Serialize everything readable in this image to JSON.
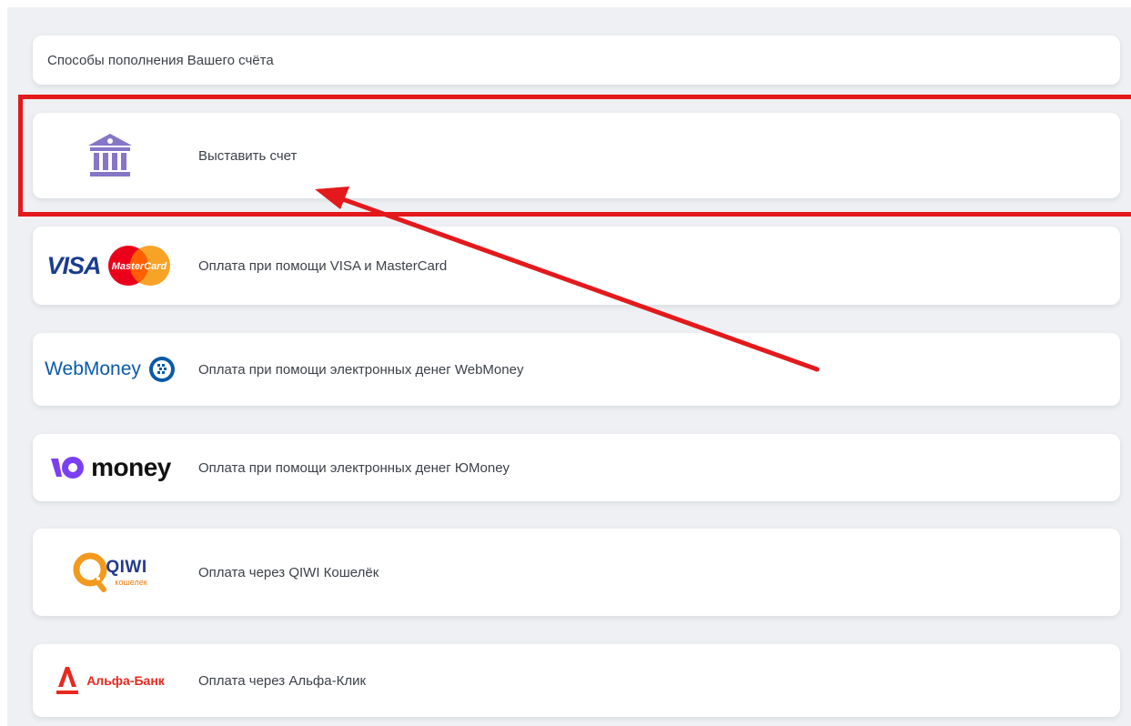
{
  "header": {
    "title": "Способы пополнения Вашего счёта"
  },
  "methods": [
    {
      "label": "Выставить счет",
      "icon": "bank-icon"
    },
    {
      "label": "Оплата при помощи VISA и MasterCard",
      "icon": "visa-mastercard-logo",
      "logo_text": "VISA",
      "logo_sub": "MasterCard"
    },
    {
      "label": "Оплата при помощи электронных денег WebMoney",
      "icon": "webmoney-logo",
      "logo_text": "WebMoney"
    },
    {
      "label": "Оплата при помощи электронных денег ЮMoney",
      "icon": "yoomoney-logo",
      "logo_text": "money"
    },
    {
      "label": "Оплата через QIWI Кошелёк",
      "icon": "qiwi-logo",
      "logo_text": "QIWI",
      "logo_sub": "кошелек"
    },
    {
      "label": "Оплата через Альфа-Клик",
      "icon": "alfa-bank-logo",
      "logo_text": "Альфа-Банк"
    }
  ],
  "colors": {
    "background": "#eef0f3",
    "highlight": "#e3191b",
    "bank_icon": "#8576c8",
    "text": "#3c4148"
  }
}
